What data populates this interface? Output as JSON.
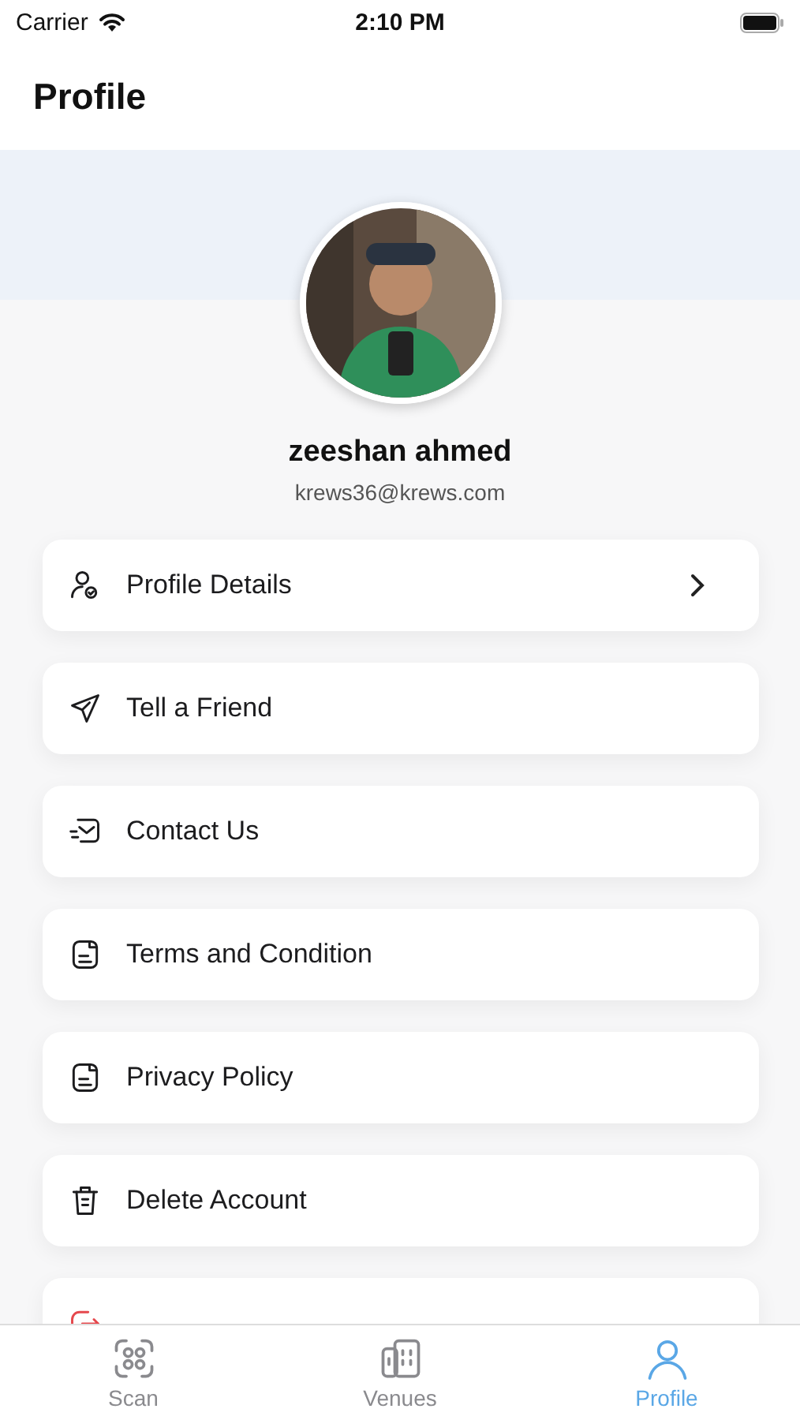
{
  "status_bar": {
    "carrier": "Carrier",
    "time": "2:10 PM"
  },
  "header": {
    "title": "Profile"
  },
  "profile": {
    "name": "zeeshan ahmed",
    "email": "krews36@krews.com"
  },
  "menu": [
    {
      "label": "Profile Details",
      "kind": "standard",
      "chevron": true
    },
    {
      "label": "Tell a Friend",
      "kind": "standard",
      "chevron": false
    },
    {
      "label": "Contact Us",
      "kind": "standard",
      "chevron": false
    },
    {
      "label": "Terms and Condition",
      "kind": "standard",
      "chevron": false
    },
    {
      "label": "Privacy Policy",
      "kind": "standard",
      "chevron": false
    },
    {
      "label": "Delete Account",
      "kind": "standard",
      "chevron": false
    },
    {
      "kind": "destructive",
      "chevron": false
    }
  ],
  "tab_bar": [
    {
      "label": "Scan",
      "selected": false
    },
    {
      "label": "Venues",
      "selected": false
    },
    {
      "label": "Profile",
      "selected": true
    }
  ]
}
